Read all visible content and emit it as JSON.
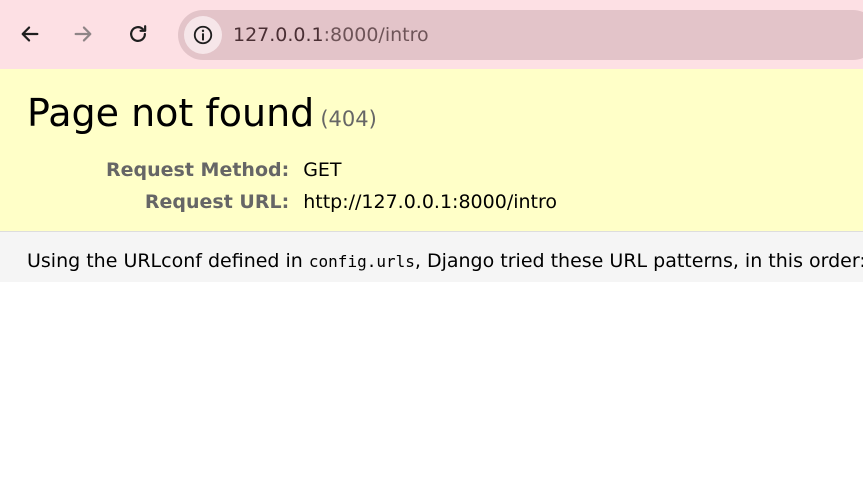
{
  "browser": {
    "url_host": "127.0.0.1",
    "url_port_path": ":8000/intro",
    "back_icon": "arrow-left-icon",
    "forward_icon": "arrow-right-icon",
    "reload_icon": "reload-icon",
    "site_info_icon": "info-circle-icon",
    "colors": {
      "toolbar_bg": "#fde0e4",
      "omnibox_bg": "#e3c4c9"
    }
  },
  "error": {
    "title": "Page not found",
    "status": "(404)",
    "request_method_label": "Request Method:",
    "request_method": "GET",
    "request_url_label": "Request URL:",
    "request_url": "http://127.0.0.1:8000/intro"
  },
  "info": {
    "prefix": "Using the URLconf defined in ",
    "urlconf": "config.urls",
    "suffix": ", Django tried these URL patterns, in this order:"
  },
  "colors": {
    "summary_bg": "#ffffc8",
    "info_bg": "#f5f5f5"
  }
}
